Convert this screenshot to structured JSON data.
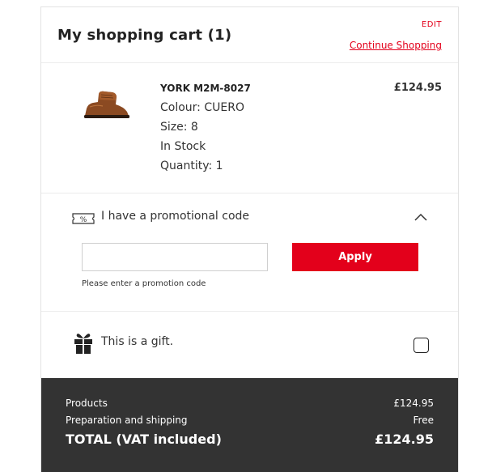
{
  "header": {
    "title": "My shopping cart (1)",
    "edit_label": "EDIT",
    "continue_label": "Continue Shopping"
  },
  "item": {
    "name": "YORK M2M-8027",
    "price": "£124.95",
    "colour": "Colour: CUERO",
    "size": "Size: 8",
    "stock": "In Stock",
    "quantity": "Quantity: 1",
    "image_icon": "brown-leather-boot"
  },
  "promo": {
    "label": "I have a promotional code",
    "input_value": "",
    "apply_label": "Apply",
    "hint": "Please enter a promotion code"
  },
  "gift": {
    "label": "This is a gift."
  },
  "summary": {
    "products_label": "Products",
    "products_value": "£124.95",
    "shipping_label": "Preparation and shipping",
    "shipping_value": "Free",
    "total_label": "TOTAL (VAT included)",
    "total_value": "£124.95"
  },
  "colors": {
    "accent": "#e3001b",
    "summary_bg": "#333333"
  }
}
